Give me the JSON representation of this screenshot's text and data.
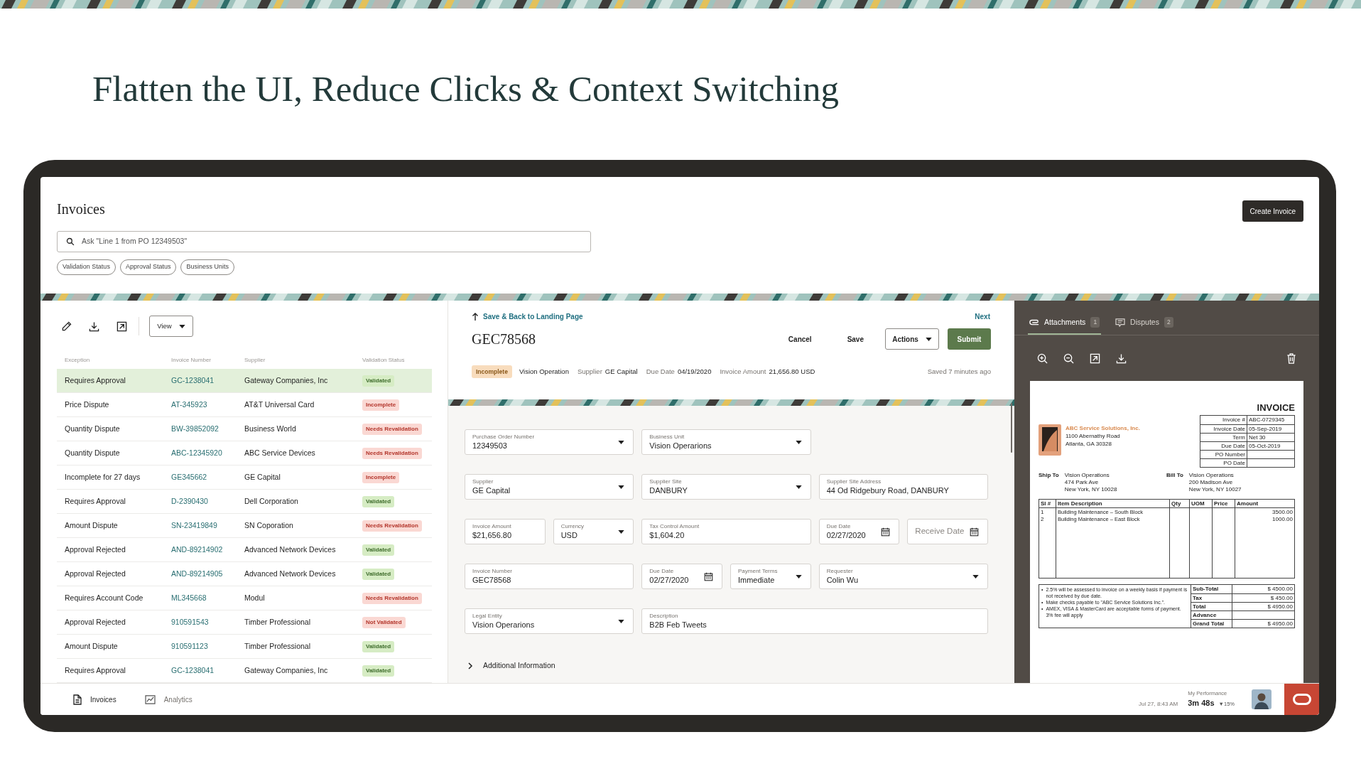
{
  "headline": "Flatten the UI, Reduce Clicks & Context Switching",
  "app": {
    "title": "Invoices",
    "create_button": "Create Invoice",
    "search": {
      "placeholder": "Ask \"Line 1 from PO 12349503\""
    },
    "filters": [
      "Validation Status",
      "Approval Status",
      "Business Units"
    ]
  },
  "list": {
    "view_button": "View",
    "columns": [
      "Exception",
      "Invoice Number",
      "Supplier",
      "Validation Status"
    ],
    "rows": [
      {
        "exception": "Requires Approval",
        "invoice_number": "GC-1238041",
        "supplier": "Gateway Companies, Inc",
        "status": "Validated",
        "kind": "success",
        "selected": true
      },
      {
        "exception": "Price Dispute",
        "invoice_number": "AT-345923",
        "supplier": "AT&T Universal Card",
        "status": "Incomplete",
        "kind": "error",
        "selected": false
      },
      {
        "exception": "Quantity Dispute",
        "invoice_number": "BW-39852092",
        "supplier": "Business World",
        "status": "Needs Revalidation",
        "kind": "error",
        "selected": false
      },
      {
        "exception": "Quantity Dispute",
        "invoice_number": "ABC-12345920",
        "supplier": "ABC Service Devices",
        "status": "Needs Revalidation",
        "kind": "error",
        "selected": false
      },
      {
        "exception": "Incomplete for 27 days",
        "invoice_number": "GE345662",
        "supplier": "GE Capital",
        "status": "Incomplete",
        "kind": "error",
        "selected": false
      },
      {
        "exception": "Requires Approval",
        "invoice_number": "D-2390430",
        "supplier": "Dell Corporation",
        "status": "Validated",
        "kind": "success",
        "selected": false
      },
      {
        "exception": "Amount Dispute",
        "invoice_number": "SN-23419849",
        "supplier": "SN Coporation",
        "status": "Needs Revalidation",
        "kind": "error",
        "selected": false
      },
      {
        "exception": "Approval Rejected",
        "invoice_number": "AND-89214902",
        "supplier": "Advanced Network Devices",
        "status": "Validated",
        "kind": "success",
        "selected": false
      },
      {
        "exception": "Approval Rejected",
        "invoice_number": "AND-89214905",
        "supplier": "Advanced Network Devices",
        "status": "Validated",
        "kind": "success",
        "selected": false
      },
      {
        "exception": "Requires Account Code",
        "invoice_number": "ML345668",
        "supplier": "Modul",
        "status": "Needs Revalidation",
        "kind": "error",
        "selected": false
      },
      {
        "exception": "Approval Rejected",
        "invoice_number": "910591543",
        "supplier": "Timber Professional",
        "status": "Not Validated",
        "kind": "error",
        "selected": false
      },
      {
        "exception": "Amount Dispute",
        "invoice_number": "910591123",
        "supplier": "Timber Professional",
        "status": "Validated",
        "kind": "success",
        "selected": false
      },
      {
        "exception": "Requires Approval",
        "invoice_number": "GC-1238041",
        "supplier": "Gateway Companies, Inc",
        "status": "Validated",
        "kind": "success",
        "selected": false
      }
    ]
  },
  "detail": {
    "back_link": "Save & Back to Landing Page",
    "next_link": "Next",
    "invoice_id": "GEC78568",
    "buttons": {
      "cancel": "Cancel",
      "save": "Save",
      "actions": "Actions",
      "submit": "Submit"
    },
    "status_badge": "Incomplete",
    "business_unit": "Vision Operation",
    "facts": [
      {
        "label": "Supplier",
        "value": "GE Capital"
      },
      {
        "label": "Due Date",
        "value": "04/19/2020"
      },
      {
        "label": "Invoice Amount",
        "value": "21,656.80 USD"
      }
    ],
    "saved": "Saved 7 minutes ago"
  },
  "form": {
    "fields": [
      {
        "label": "Purchase Order Number",
        "value": "12349503",
        "kind": "select"
      },
      {
        "label": "Business Unit",
        "value": "Vision Operarions",
        "kind": "select"
      },
      {
        "label": "Supplier",
        "value": "GE Capital",
        "kind": "select"
      },
      {
        "label": "Supplier Site",
        "value": "DANBURY",
        "kind": "select"
      },
      {
        "label": "Supplier Site Address",
        "value": "44 Od Ridgebury Road, DANBURY",
        "kind": "text"
      },
      {
        "label": "Invoice Amount",
        "value": "$21,656.80",
        "kind": "text"
      },
      {
        "label": "Currency",
        "value": "USD",
        "kind": "select"
      },
      {
        "label": "Tax Control Amount",
        "value": "$1,604.20",
        "kind": "text"
      },
      {
        "label": "Due Date",
        "value": "02/27/2020",
        "kind": "date"
      },
      {
        "placeholder": "Receive Date",
        "kind": "date"
      },
      {
        "label": "Invoice Number",
        "value": "GEC78568",
        "kind": "text"
      },
      {
        "label": "Due Date",
        "value": "02/27/2020",
        "kind": "date"
      },
      {
        "label": "Payment Terms",
        "value": "Immediate",
        "kind": "select"
      },
      {
        "label": "Requester",
        "value": "Colin Wu",
        "kind": "select"
      },
      {
        "label": "Legal Entity",
        "value": "Vision Operarions",
        "kind": "select"
      },
      {
        "label": "Description",
        "value": "B2B Feb Tweets",
        "kind": "text"
      }
    ],
    "additional": {
      "label": "Additional Information",
      "expanded": false
    }
  },
  "viewer": {
    "tabs": [
      {
        "label": "Attachments",
        "count": "1",
        "selected": true
      },
      {
        "label": "Disputes",
        "count": "2",
        "selected": false
      }
    ],
    "document": {
      "title": "INVOICE",
      "company": "ABC Service Solutions, Inc.",
      "company_address": [
        "1100 Abernathy Road",
        "Atlanta, GA 30328"
      ],
      "meta": [
        {
          "label": "Invoice #",
          "value": "ABC-0729345"
        },
        {
          "label": "Invoice Date",
          "value": "05-Sep-2019"
        },
        {
          "label": "Term",
          "value": "Net 30"
        },
        {
          "label": "Due Date",
          "value": "05-Oct-2019"
        },
        {
          "label": "PO Number"
        },
        {
          "label": "PO Date"
        }
      ],
      "parties": [
        {
          "label": "Ship To",
          "lines": [
            "Vision Operations",
            "474 Park Ave",
            "New York, NY 10028"
          ]
        },
        {
          "label": "Bill To",
          "lines": [
            "Vision Operations",
            "200 Madison Ave",
            "New York, NY 10027"
          ]
        }
      ],
      "item_columns": [
        "Sl #",
        "Item Description",
        "Qty",
        "UOM",
        "Price",
        "Amount"
      ],
      "items": [
        {
          "number": "1",
          "description": "Building Maintenance – South Block",
          "amount": "3500.00"
        },
        {
          "number": "2",
          "description": "Building Maintenance – East Block",
          "amount": "1000.00"
        }
      ],
      "notes": [
        {
          "marker": "•",
          "text": "2.5% will be assessed to invoice on a weekly basis if payment is not received by due date."
        },
        {
          "marker": "•",
          "text": "Make checks payable to \"ABC Service Solutions Inc.\"."
        },
        {
          "marker": "•",
          "text": "AMEX, VISA & MasterCard are acceptable forms of payment. 3% fee will apply"
        }
      ],
      "totals": [
        {
          "label": "Sub-Total",
          "value": "$ 4500.00"
        },
        {
          "label": "Tax",
          "value": "$ 450.00"
        },
        {
          "label": "Total",
          "value": "$ 4950.00"
        },
        {
          "label": "Advance"
        },
        {
          "label": "Grand Total",
          "value": "$ 4950.00"
        }
      ]
    }
  },
  "footer": {
    "nav": [
      {
        "label": "Invoices",
        "selected": true
      },
      {
        "label": "Analytics",
        "selected": false
      }
    ],
    "timestamp": "Jul 27, 8:43 AM",
    "performance": {
      "label": "My Performance",
      "value": "3m 48s",
      "change": "▼15%"
    }
  }
}
